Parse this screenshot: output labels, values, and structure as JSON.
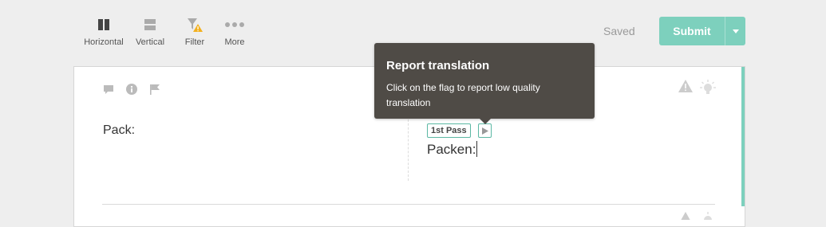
{
  "toolbar": {
    "horizontal_label": "Horizontal",
    "vertical_label": "Vertical",
    "filter_label": "Filter",
    "more_label": "More",
    "saved_label": "Saved",
    "submit_label": "Submit"
  },
  "segment": {
    "source_text": "Pack:",
    "pass_badge": "1st Pass",
    "target_text": "Packen:"
  },
  "tooltip": {
    "title": "Report translation",
    "body": "Click on the flag to report low quality translation"
  },
  "colors": {
    "accent": "#7dd0bd",
    "tooltip_bg": "#4f4b46",
    "warning": "#f2b01e"
  },
  "icons": [
    "columns-icon",
    "rows-icon",
    "filter-warning-icon",
    "more-dots-icon",
    "chevron-down-icon",
    "comment-icon",
    "info-icon",
    "flag-icon",
    "warning-icon",
    "lightbulb-icon",
    "play-flag-icon"
  ]
}
